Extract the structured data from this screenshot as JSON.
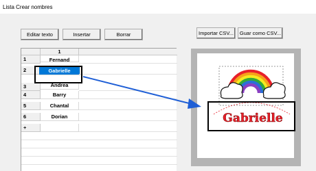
{
  "window": {
    "title": "Lista Crear nombres"
  },
  "toolbar": {
    "edit_text": "Editar texto",
    "insert": "Insertar",
    "delete": "Borrar",
    "import_csv": "Importar CSV...",
    "save_csv": "Guar como CSV..."
  },
  "grid": {
    "column_header": "1",
    "rows": [
      {
        "num": "1",
        "name": "Fernand"
      },
      {
        "num": "2",
        "name": "Gabrielle"
      },
      {
        "num": "3",
        "name": "Andrea"
      },
      {
        "num": "4",
        "name": "Barry"
      },
      {
        "num": "5",
        "name": "Chantal"
      },
      {
        "num": "6",
        "name": "Dorian"
      }
    ],
    "new_row_marker": "+"
  },
  "preview": {
    "embroidery_text": "Gabrielle",
    "text_color": "#e8202a",
    "highlight_color": "#000000",
    "arrow_color": "#1f5fd6"
  }
}
